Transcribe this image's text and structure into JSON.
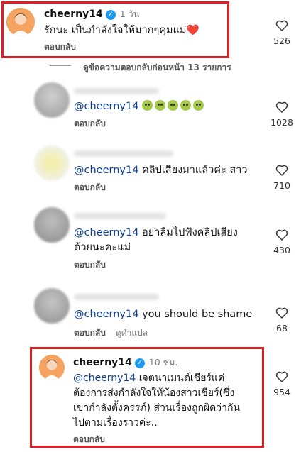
{
  "comments": [
    {
      "username": "cheerny14",
      "time": "1 วัน",
      "text": "รักนะ เป็นกำลังใจให้มากๆคุมแม่",
      "emoji": "❤️",
      "reply": "ตอบกลับ",
      "likes": "526"
    }
  ],
  "view_replies": "ดูข้อความตอบกลับก่อนหน้า 13 รายการ",
  "replies": [
    {
      "mention": "@cheerny14",
      "text": "😖😖😖😖😖",
      "reply": "ตอบกลับ",
      "likes": "1028"
    },
    {
      "mention": "@cheerny14",
      "text": "คลิปเสียงมาแล้วค่ะ สาว",
      "reply": "ตอบกลับ",
      "likes": "710"
    },
    {
      "mention": "@cheerny14",
      "text_line1": "อย่าลืมไปฟังคลิปเสียง",
      "text_line2": "ด้วยนะคะแม่",
      "reply": "ตอบกลับ",
      "likes": "430"
    },
    {
      "mention": "@cheerny14",
      "text": "you should be shame",
      "reply": "ตอบกลับ",
      "translate": "ดูคำแปล",
      "likes": "68"
    }
  ],
  "final_reply": {
    "username": "cheerny14",
    "time": "10 ชม.",
    "mention": "@cheerny14",
    "line1": "เจตนาเมนต์เชียร์แค่",
    "line2": "ต้องการส่งกำลังใจให้น้องสาวเชียร์(ซึ่ง",
    "line3": "เขากำลังตั้งครรภ์) ส่วนเรื่องถูกผิดว่ากัน",
    "line4": "ไปตามเรื่องราวค่ะ..",
    "reply": "ตอบกลับ",
    "likes": "954"
  },
  "colors": {
    "highlight": "#e11c23",
    "mention": "#0b3d91",
    "verified": "#1d9bf0"
  },
  "icons": {
    "like": "heart-outline-icon",
    "verified": "verified-badge-icon"
  }
}
